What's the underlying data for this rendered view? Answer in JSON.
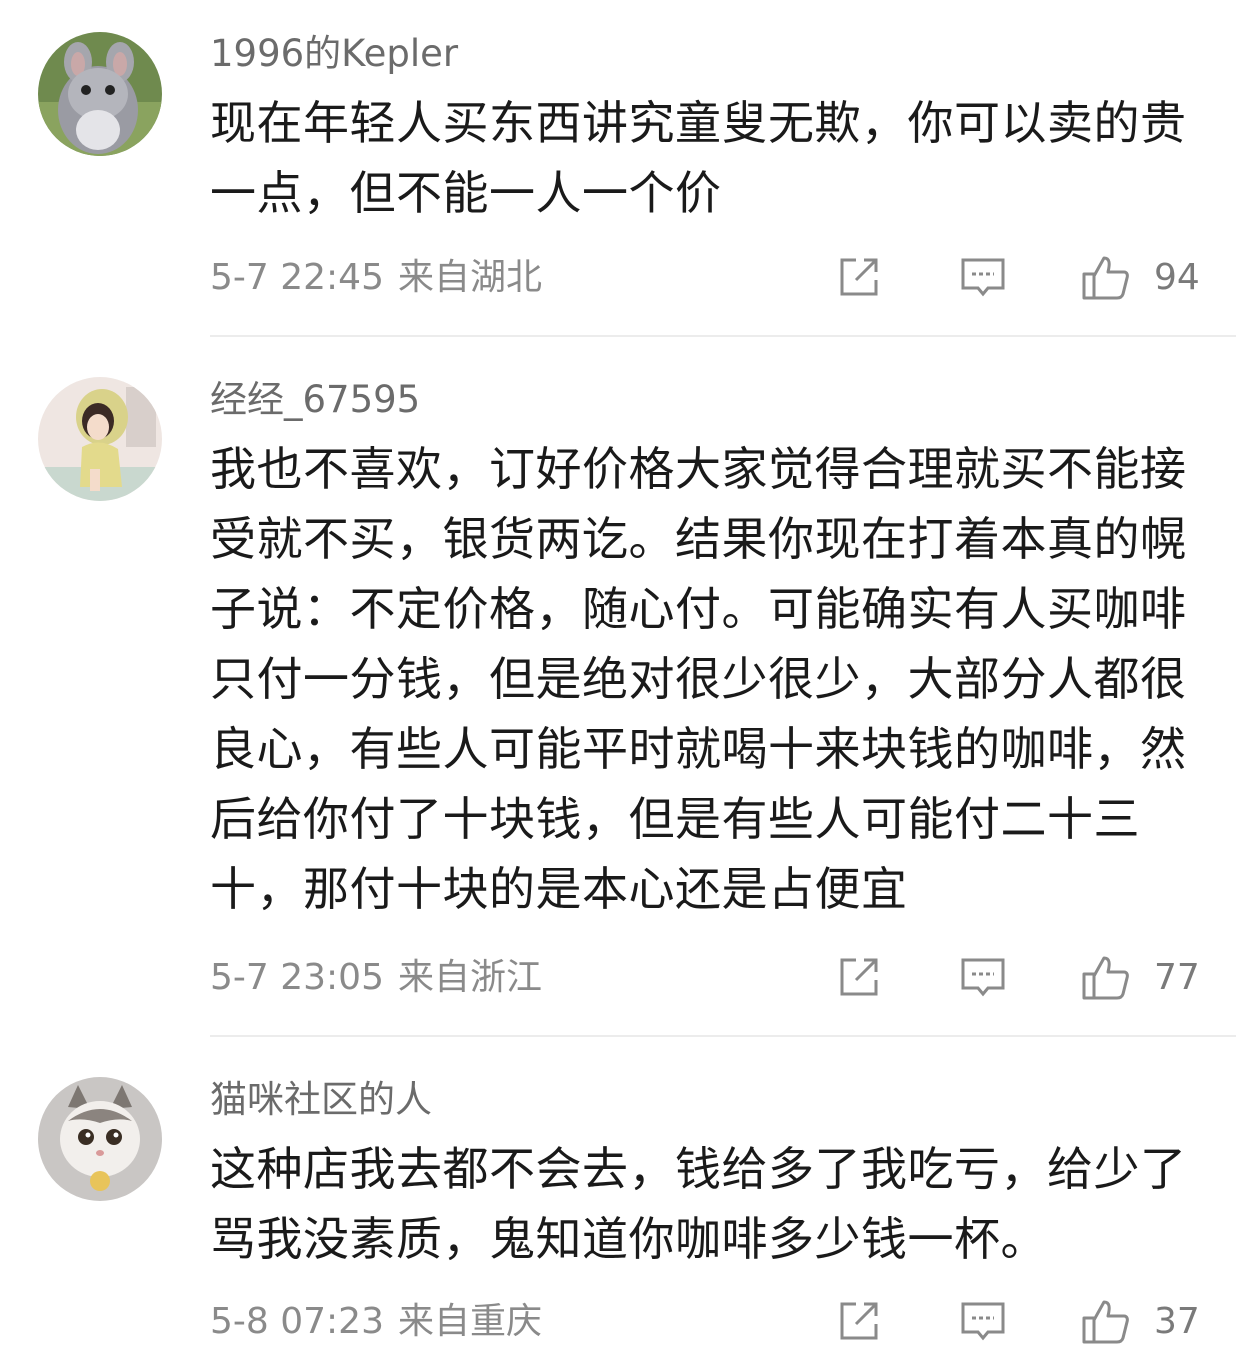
{
  "comments": [
    {
      "username": "1996的Kepler",
      "text": "现在年轻人买东西讲究童叟无欺，你可以卖的贵一点，但不能一人一个价",
      "time": "5-7 22:45",
      "location": "来自湖北",
      "likes": "94",
      "avatar": "chinchilla-avatar"
    },
    {
      "username": "经经_67595",
      "text": "我也不喜欢，订好价格大家觉得合理就买不能接受就不买，银货两讫。结果你现在打着本真的幌子说：不定价格，随心付。可能确实有人买咖啡只付一分钱，但是绝对很少很少，大部分人都很良心，有些人可能平时就喝十来块钱的咖啡，然后给你付了十块钱，但是有些人可能付二十三十，那付十块的是本心还是占便宜",
      "time": "5-7 23:05",
      "location": "来自浙江",
      "likes": "77",
      "avatar": "anime-girl-avatar"
    },
    {
      "username": "猫咪社区的人",
      "text": "这种店我去都不会去，钱给多了我吃亏，给少了骂我没素质，鬼知道你咖啡多少钱一杯。",
      "time": "5-8 07:23",
      "location": "来自重庆",
      "likes": "37",
      "avatar": "cat-avatar"
    }
  ],
  "icons": [
    "share-icon",
    "reply-icon",
    "like-icon"
  ],
  "colors": {
    "username": "#6b6b6b",
    "text": "#1a1a1a",
    "meta": "#8a8a8a",
    "icon": "#8a8a8a",
    "divider": "#ececec"
  }
}
